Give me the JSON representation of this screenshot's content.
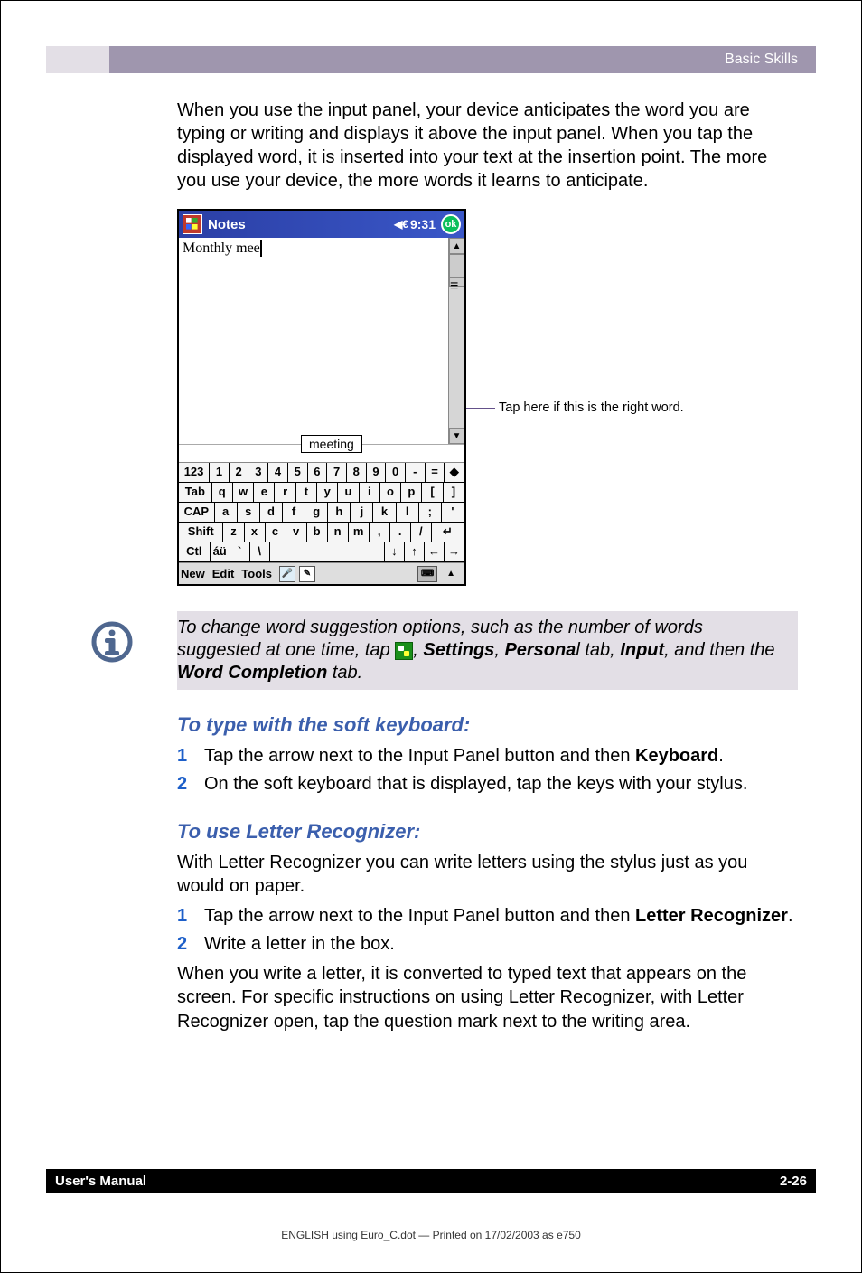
{
  "header": {
    "section_title": "Basic Skills"
  },
  "intro_paragraph": "When you use the input panel, your device anticipates the word you are typing or writing and displays it above the input panel. When you tap the displayed word, it is inserted into your text at the insertion point. The more you use your device, the more words it learns to anticipate.",
  "screenshot": {
    "app_name": "Notes",
    "time": "9:31",
    "ok_label": "ok",
    "typed_text": "Monthly mee",
    "suggestion": "meeting",
    "bottombar": {
      "new": "New",
      "edit": "Edit",
      "tools": "Tools"
    },
    "keyboard": {
      "row1": [
        "123",
        "1",
        "2",
        "3",
        "4",
        "5",
        "6",
        "7",
        "8",
        "9",
        "0",
        "-",
        "=",
        "◆"
      ],
      "row2": [
        "Tab",
        "q",
        "w",
        "e",
        "r",
        "t",
        "y",
        "u",
        "i",
        "o",
        "p",
        "[",
        "]"
      ],
      "row3": [
        "CAP",
        "a",
        "s",
        "d",
        "f",
        "g",
        "h",
        "j",
        "k",
        "l",
        ";",
        "'"
      ],
      "row4": [
        "Shift",
        "z",
        "x",
        "c",
        "v",
        "b",
        "n",
        "m",
        ",",
        ".",
        "/",
        "↵"
      ],
      "row5": [
        "Ctl",
        "áü",
        "`",
        "\\",
        " ",
        "↓",
        "↑",
        "←",
        "→"
      ]
    }
  },
  "callout_text": "Tap here if this is the right word.",
  "tip": {
    "prefix": "To change word suggestion options, such as the number of words suggested at one time, tap ",
    "settings": "Settings",
    "comma1": ", ",
    "personal": "Persona",
    "personal_tail": "l tab, ",
    "input": "Input",
    "tail": ", and then the ",
    "word_completion": "Word Completion",
    "final": " tab."
  },
  "sections": {
    "soft_keyboard": {
      "heading": "To type with the soft keyboard:",
      "steps": [
        {
          "n": "1",
          "text_before": "Tap the arrow next to the Input Panel button and then ",
          "bold": "Keyboard",
          "after": "."
        },
        {
          "n": "2",
          "text_before": "On the soft keyboard that is displayed, tap the keys with your stylus.",
          "bold": "",
          "after": ""
        }
      ]
    },
    "letter_recognizer": {
      "heading": "To use Letter Recognizer:",
      "intro": "With Letter Recognizer you can write letters using the stylus just as you would on paper.",
      "steps": [
        {
          "n": "1",
          "text_before": "Tap the arrow next to the Input Panel button and then ",
          "bold": "Letter Recognizer",
          "after": "."
        },
        {
          "n": "2",
          "text_before": "Write a letter in the box.",
          "bold": "",
          "after": ""
        }
      ],
      "outro": "When you write a letter, it is converted to typed text that appears on the screen. For specific instructions on using Letter Recognizer, with Letter Recognizer open, tap the question mark next to the writing area."
    }
  },
  "footer": {
    "left": "User's Manual",
    "right": "2-26"
  },
  "print_line": "ENGLISH using Euro_C.dot — Printed on 17/02/2003 as e750"
}
